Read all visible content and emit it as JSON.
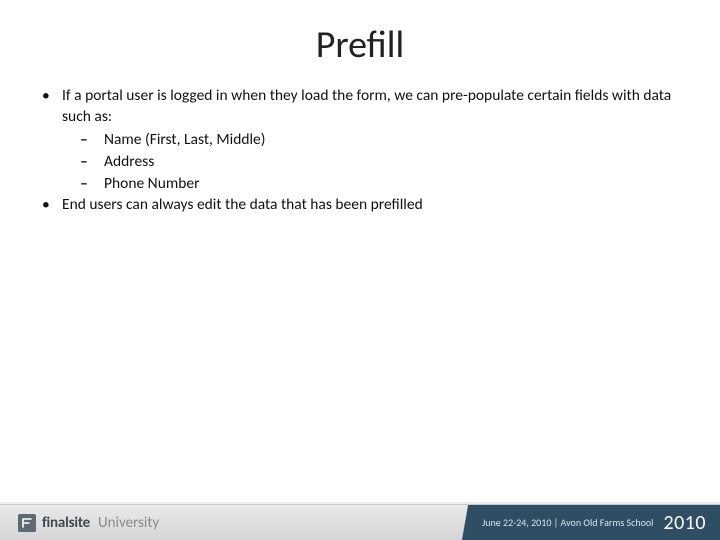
{
  "title": "Prefill",
  "bullets": [
    {
      "text": "If a portal user is logged in when they load the form, we can pre-populate certain fields with data such as:",
      "sub": [
        "Name (First, Last, Middle)",
        "Address",
        "Phone Number"
      ]
    },
    {
      "text": "End users can always edit the data that has been prefilled",
      "sub": []
    }
  ],
  "footer": {
    "brand_bold": "finalsite",
    "brand_light": "University",
    "event": "June 22-24, 2010 | Avon Old Farms School",
    "year": "2010"
  }
}
